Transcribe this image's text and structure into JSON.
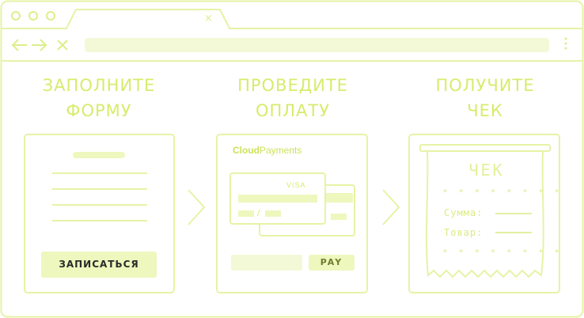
{
  "browser": {
    "tab_close": "×",
    "menu": "⋮"
  },
  "steps": [
    {
      "heading_line1": "ЗАПОЛНИТЕ",
      "heading_line2": "ФОРМУ",
      "button": "ЗАПИСАТЬСЯ"
    },
    {
      "heading_line1": "ПРОВЕДИТЕ",
      "heading_line2": "ОПЛАТУ",
      "brand_bold": "Cloud",
      "brand_rest": "Payments",
      "card_brand": "VISA",
      "card_separator": "/",
      "button": "PAY"
    },
    {
      "heading_line1": "ПОЛУЧИТЕ",
      "heading_line2": "ЧЕК",
      "receipt_title": "ЧЕК",
      "stars": "* * * * * * * *",
      "sum_label": "Сумма:",
      "item_label": "Товар:"
    }
  ],
  "colors": {
    "accent": "#d6ec6c",
    "outline": "#e6f3a6",
    "fill": "#eef7bd"
  }
}
